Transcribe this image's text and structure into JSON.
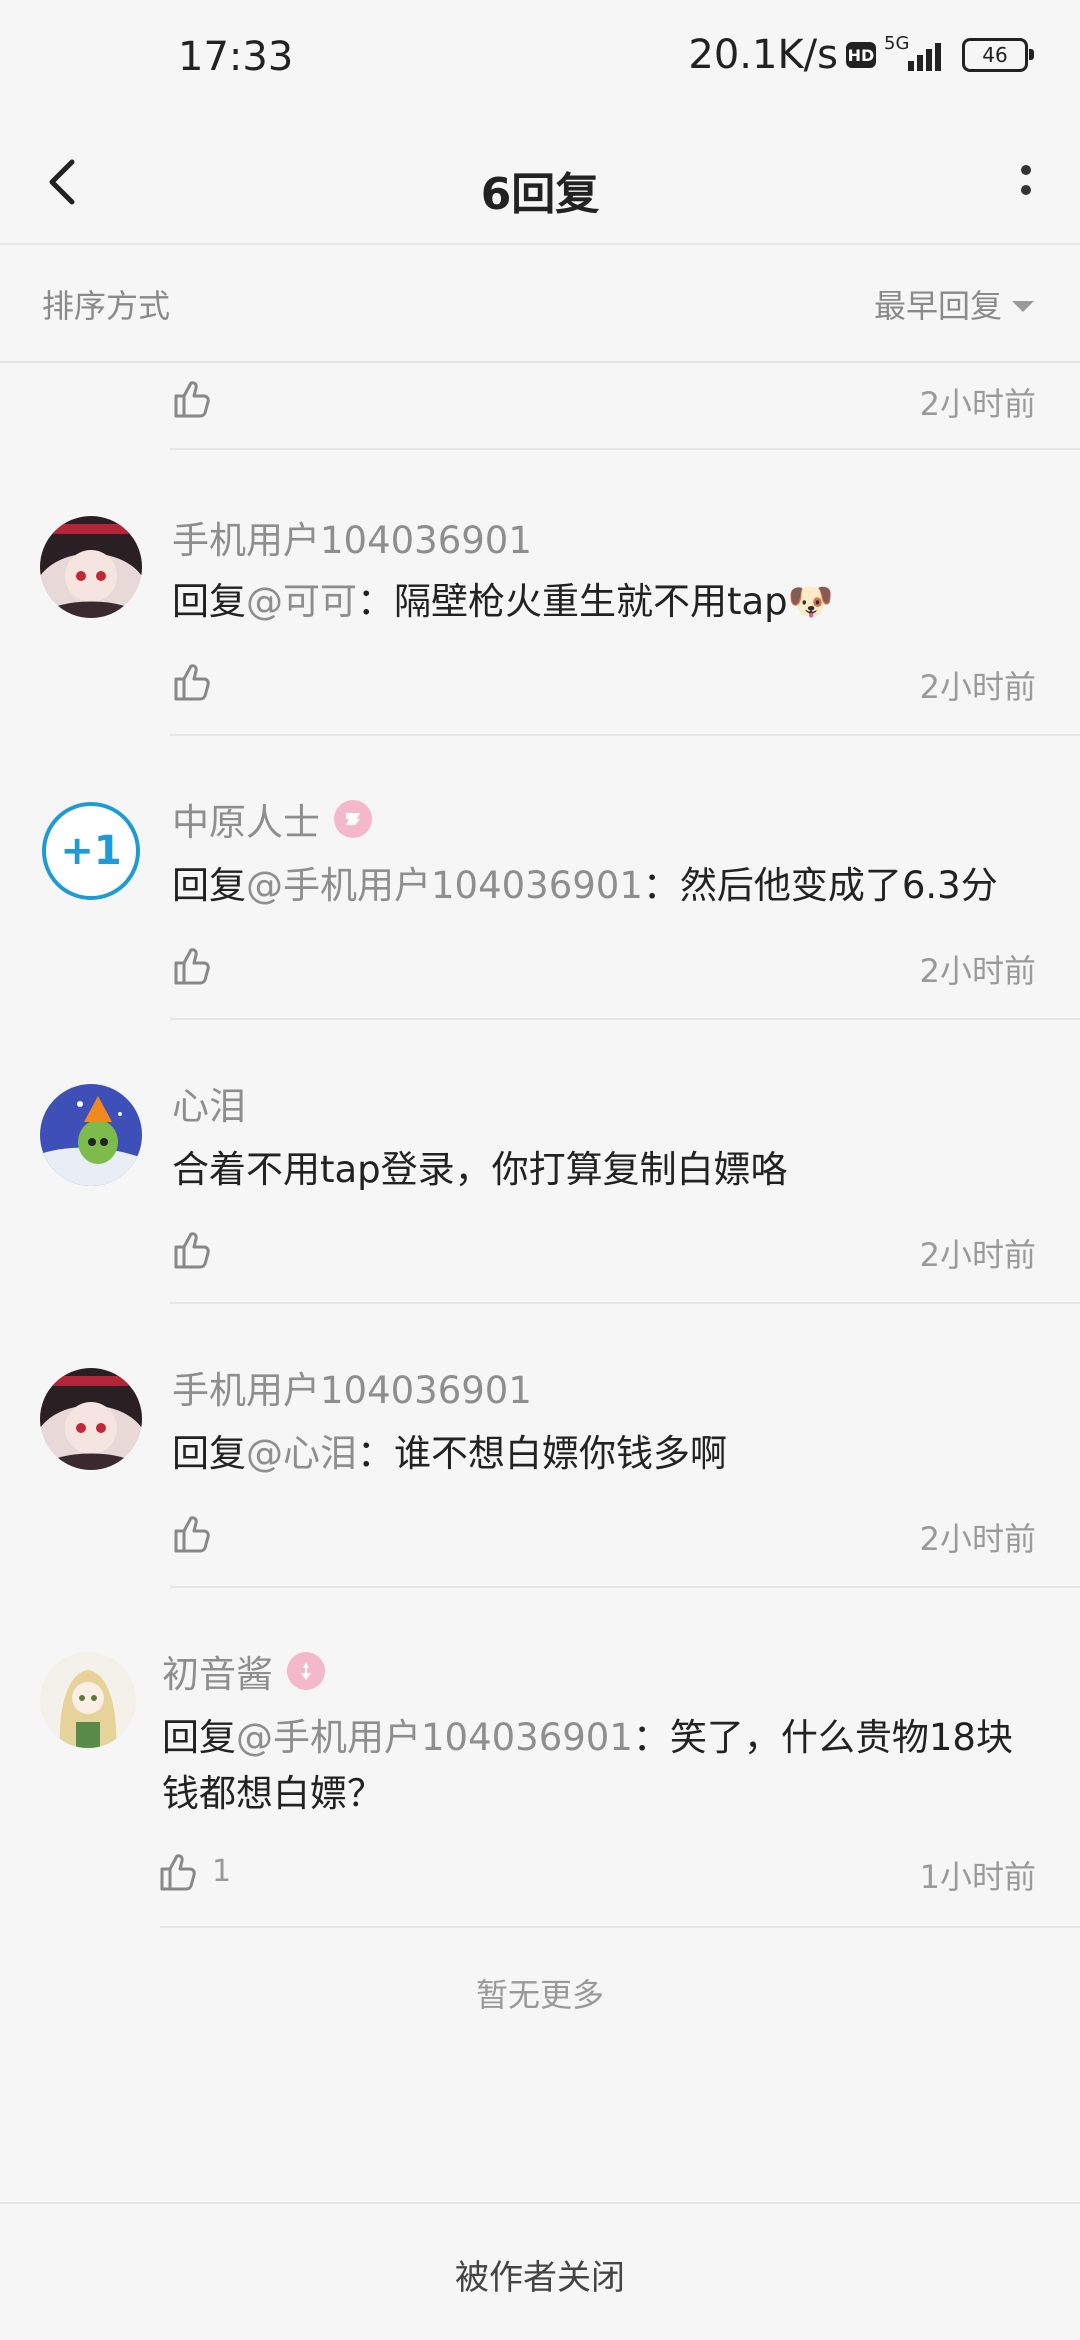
{
  "status": {
    "time": "17:33",
    "speed": "20.1K/s",
    "hd": "HD",
    "network": "5G",
    "battery": "46"
  },
  "header": {
    "title": "6回复"
  },
  "sort": {
    "label": "排序方式",
    "value": "最早回复"
  },
  "partial_row": {
    "time": "2小时前"
  },
  "comments": [
    {
      "user": "手机用户104036901",
      "reply_prefix": "回复",
      "mention": "@可可",
      "sep": "：",
      "text": "隔壁枪火重生就不用tap🐶",
      "time": "2小时前",
      "likes": ""
    },
    {
      "user": "中原人士",
      "reply_prefix": "回复",
      "mention": "@手机用户104036901",
      "sep": "：",
      "text": "然后他变成了6.3分",
      "time": "2小时前",
      "likes": ""
    },
    {
      "user": "心泪",
      "reply_prefix": "",
      "mention": "",
      "sep": "",
      "text": "合着不用tap登录，你打算复制白嫖咯",
      "time": "2小时前",
      "likes": ""
    },
    {
      "user": "手机用户104036901",
      "reply_prefix": "回复",
      "mention": "@心泪",
      "sep": "：",
      "text": "谁不想白嫖你钱多啊",
      "time": "2小时前",
      "likes": ""
    },
    {
      "user": "初音酱",
      "reply_prefix": "回复",
      "mention": "@手机用户104036901",
      "sep": "：",
      "text": "笑了，什么贵物18块",
      "text2": "钱都想白嫖？",
      "time": "1小时前",
      "likes": "1"
    }
  ],
  "footer": {
    "no_more": "暂无更多",
    "closed": "被作者关闭"
  },
  "colors": {
    "background": "#f6f6f6",
    "muted": "#8e8e8e",
    "plus_one_ring": "#1e9bd7",
    "badge_pink": "#f3b8c9"
  }
}
